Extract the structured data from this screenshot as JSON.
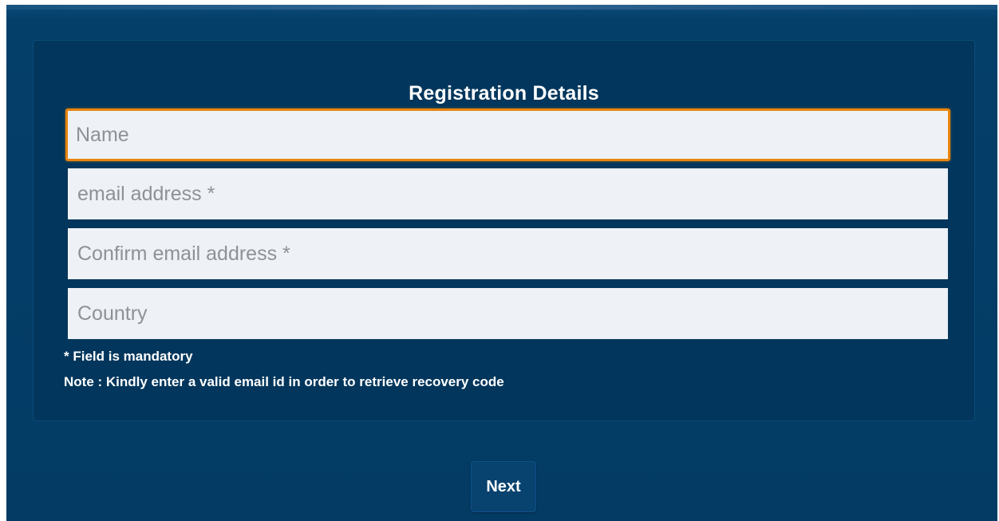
{
  "form": {
    "title": "Registration Details",
    "fields": [
      {
        "name": "name",
        "placeholder": "Name",
        "value": "",
        "focused": true
      },
      {
        "name": "email",
        "placeholder": "email address *",
        "value": ""
      },
      {
        "name": "confirm_email",
        "placeholder": "Confirm email address *",
        "value": ""
      },
      {
        "name": "country",
        "placeholder": "Country",
        "value": ""
      }
    ],
    "mandatory_note": "* Field is mandatory",
    "recovery_note": "Note : Kindly enter a valid email id in order to retrieve recovery code"
  },
  "actions": {
    "next_label": "Next"
  },
  "colors": {
    "background": "#033b64",
    "panel": "#02365c",
    "focus_border": "#e8860f",
    "field_bg": "#eef1f5"
  }
}
